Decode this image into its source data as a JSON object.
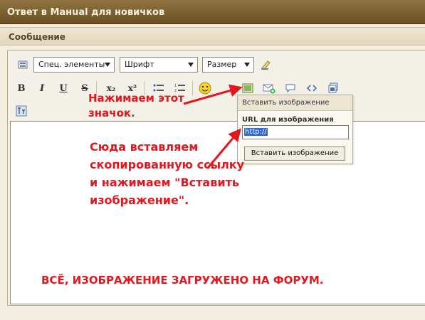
{
  "header": {
    "title": "Ответ в Манual для новичков"
  },
  "section": {
    "title": "Сообщение"
  },
  "toolbar": {
    "selects": [
      {
        "label": "Спец. элементы"
      },
      {
        "label": "Шрифт"
      },
      {
        "label": "Размер"
      }
    ],
    "format_buttons": [
      {
        "name": "bold-button",
        "label": "B"
      },
      {
        "name": "italic-button",
        "label": "I"
      },
      {
        "name": "underline-button",
        "label": "U"
      },
      {
        "name": "strikethrough-button",
        "label": "S"
      },
      {
        "name": "subscript-button",
        "label": "x₂"
      },
      {
        "name": "superscript-button",
        "label": "x²"
      }
    ]
  },
  "popup": {
    "title": "Вставить изображение",
    "url_label": "URL для изображения",
    "url_value": "http://",
    "insert_button": "Вставить изображение"
  },
  "annotations": {
    "step1": "Нажимаем этот значок.",
    "step2": "Сюда вставляем скопированную ссылку и нажимаем \"Вставить изображение\".",
    "done": "ВСЁ, ИЗОБРАЖЕНИЕ ЗАГРУЖЕНО НА ФОРУМ."
  },
  "colors": {
    "header_bg": "#7a5f31",
    "annotation": "#e3171d",
    "selection": "#3366cc"
  }
}
